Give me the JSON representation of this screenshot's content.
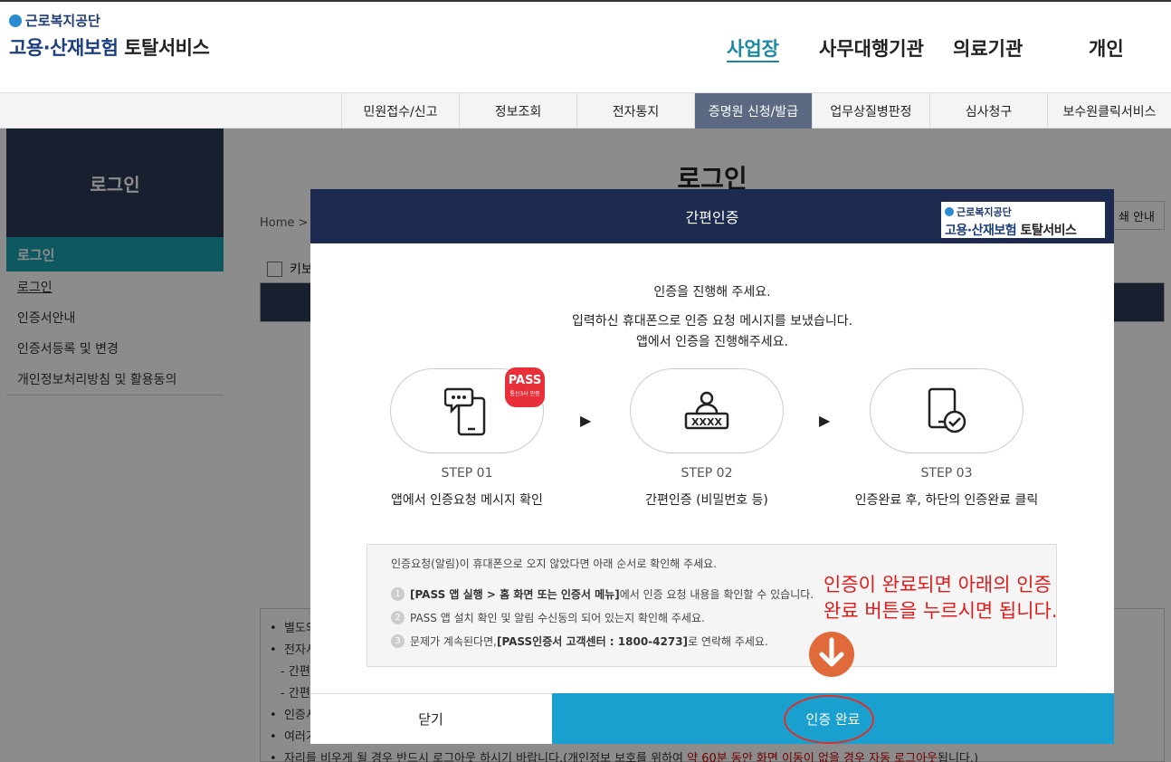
{
  "header": {
    "logo_org": "근로복지공단",
    "logo_title_a": "고용·산재보험",
    "logo_title_b": "토탈서비스",
    "gnb": [
      "사업장",
      "사무대행기관",
      "의료기관",
      "개인"
    ],
    "gnb_active": "사업장"
  },
  "lnb": {
    "items": [
      "민원접수/신고",
      "정보조회",
      "전자통지",
      "증명원 신청/발급",
      "업무상질병판정",
      "심사청구",
      "보수원클릭서비스"
    ],
    "active": "증명원 신청/발급"
  },
  "sidebar": {
    "title": "로그인",
    "active_item": "로그인",
    "items": [
      "로그인",
      "인증서안내",
      "인증서등록 및 변경",
      "개인정보처리방침 및 활용동의"
    ]
  },
  "content": {
    "title": "로그인",
    "breadcrumb": "Home > 로",
    "print_label": "쇄 안내",
    "keyboard_label": "키보",
    "notice_items": [
      "별도의",
      "전자서",
      "- 간편",
      "- 간편",
      "인증서",
      "여러가"
    ],
    "notice_last_a": "자리를 비우게 될 경우 반드시 로그아웃 하시기 바랍니다.(개인정보 보호를 위하여 ",
    "notice_last_red": "약 60분 동안 화면 이동이 없을 경우 자동 로그아웃",
    "notice_last_b": "됩니다.)"
  },
  "modal": {
    "title": "간편인증",
    "logo_org": "근로복지공단",
    "logo_title_a": "고용·산재보험",
    "logo_title_b": "토탈서비스",
    "msg1": "인증을 진행해 주세요.",
    "msg2": "입력하신 휴대폰으로 인증 요청 메시지를 보냈습니다.",
    "msg3": "앱에서 인증을 진행해주세요.",
    "pass_label": "PASS",
    "pass_sub": "통신3사 인증",
    "steps": [
      {
        "num": "STEP 01",
        "desc": "앱에서 인증요청 메시지 확인"
      },
      {
        "num": "STEP 02",
        "desc": "간편인증 (비밀번호 등)"
      },
      {
        "num": "STEP 03",
        "desc": "인증완료 후, 하단의 인증완료 클릭"
      }
    ],
    "pin_mask": "XXXX",
    "help_lead": "인증요청(알림)이 휴대폰으로 오지 않았다면 아래 순서로 확인해 주세요.",
    "help_items": [
      {
        "num": "1",
        "bold": "[PASS 앱 실행 > 홈 화면 또는 인증서 메뉴]",
        "text": " 에서 인증 요청 내용을 확인할 수 있습니다."
      },
      {
        "num": "2",
        "bold": "",
        "text": "PASS 앱 설치 확인 및 알림 수신동의 되어 있는지 확인해 주세요."
      },
      {
        "num": "3",
        "bold": "[PASS인증서 고객센터 : 1800-4273]",
        "pre": "문제가 계속된다면, ",
        "text": " 로 연락해 주세요."
      }
    ],
    "close_label": "닫기",
    "confirm_label": "인증 완료"
  },
  "annotation": {
    "line1": "인증이 완료되면 아래의 인증",
    "line2": "완료 버튼을 누르시면 됩니다."
  },
  "colors": {
    "modal_header": "#1b2a4e",
    "confirm_button": "#1aa0cf",
    "annotation_red": "#e01b1b",
    "pass_red": "#e8303a"
  }
}
